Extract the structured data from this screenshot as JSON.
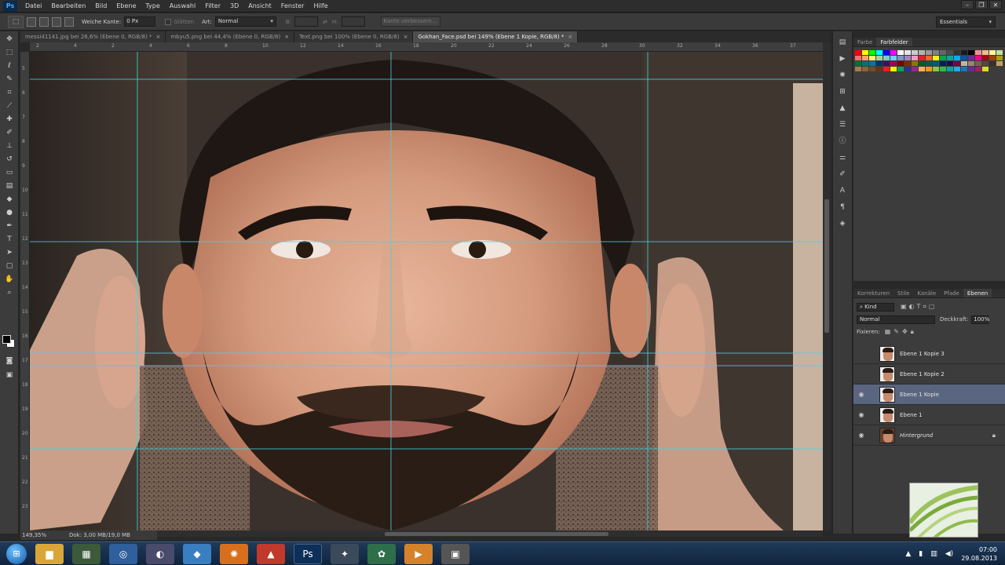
{
  "app": {
    "logo": "Ps"
  },
  "menu": [
    "Datei",
    "Bearbeiten",
    "Bild",
    "Ebene",
    "Type",
    "Auswahl",
    "Filter",
    "3D",
    "Ansicht",
    "Fenster",
    "Hilfe"
  ],
  "window_controls": {
    "minimize": "–",
    "restore": "❐",
    "close": "✕"
  },
  "options_bar": {
    "feather_label": "Weiche Kante:",
    "feather_value": "0 Px",
    "antialias_label": "Glätten",
    "style_label": "Art:",
    "style_value": "Normal",
    "width_label": "B:",
    "height_label": "H:",
    "refine_button": "Kante verbessern...",
    "workspace": "Essentials"
  },
  "tabs": [
    {
      "label": "messi41141.jpg bei 26,6% (Ebene 0, RGB/8) *",
      "close": "×",
      "active": false
    },
    {
      "label": "mbyu5.png bei 44,4% (Ebene 0, RGB/8)",
      "close": "×",
      "active": false
    },
    {
      "label": "Text.png bei 100% (Ebene 0, RGB/8)",
      "close": "×",
      "active": false
    },
    {
      "label": "Gokhan_Face.psd bei 149% (Ebene 1 Kopie, RGB/8) *",
      "close": "×",
      "active": true
    }
  ],
  "ruler_h": [
    "2",
    "4",
    "2",
    "4",
    "6",
    "8",
    "10",
    "12",
    "14",
    "16",
    "18",
    "20",
    "22",
    "24",
    "26",
    "28",
    "30",
    "32",
    "34",
    "36",
    "37"
  ],
  "ruler_v": [
    "5",
    "6",
    "7",
    "8",
    "9",
    "10",
    "11",
    "12",
    "13",
    "14",
    "15",
    "16",
    "17",
    "18",
    "19",
    "20",
    "21",
    "22",
    "23"
  ],
  "status": {
    "zoom": "149,35%",
    "doc": "Dok: 3,00 MB/19,0 MB"
  },
  "color_panel": {
    "tabs": [
      "Farbe",
      "Farbfelder"
    ],
    "active": "Farbfelder"
  },
  "swatches": [
    "#ff0000",
    "#ffff00",
    "#00ff00",
    "#00ffff",
    "#0000ff",
    "#ff00ff",
    "#ffffff",
    "#e6e6e6",
    "#cccccc",
    "#b3b3b3",
    "#999999",
    "#808080",
    "#666666",
    "#4d4d4d",
    "#333333",
    "#1a1a1a",
    "#000000",
    "#f28d8d",
    "#f6b98c",
    "#fff799",
    "#c4df9b",
    "#f46f6f",
    "#f7a46c",
    "#fff46e",
    "#a3d39c",
    "#7accc8",
    "#6dcff6",
    "#8393ca",
    "#a186be",
    "#f49ac1",
    "#ed1c24",
    "#f26522",
    "#fff200",
    "#00a651",
    "#00a99d",
    "#00aeef",
    "#0054a6",
    "#662d91",
    "#ec008c",
    "#9e0b0f",
    "#a0410d",
    "#aba000",
    "#007236",
    "#00746b",
    "#0076a3",
    "#003471",
    "#440e62",
    "#9e005d",
    "#790000",
    "#7b2e00",
    "#827b00",
    "#005e20",
    "#005952",
    "#005b7f",
    "#002157",
    "#32004b",
    "#7b0046",
    "#c7b299",
    "#998675",
    "#736357",
    "#534741",
    "#37302a",
    "#c69c6d",
    "#a67c52",
    "#8c6239",
    "#754c24",
    "#603913",
    "#ed1c24",
    "#fff200",
    "#00a651",
    "#2e3192",
    "#92278f",
    "#fbaf5d",
    "#f7941d",
    "#8dc63f",
    "#39b54a",
    "#00a99d",
    "#27aae1",
    "#1c75bc",
    "#662d91",
    "#9e1f63",
    "#d7df23"
  ],
  "layers_panel": {
    "tabs": [
      "Korrekturen",
      "Stile",
      "Kanäle",
      "Pfade",
      "Ebenen"
    ],
    "active": "Ebenen",
    "filter_label": "Kind",
    "blend_mode": "Normal",
    "opacity_label": "Deckkraft:",
    "opacity_value": "100%",
    "lock_label": "Fixieren:",
    "layers": [
      {
        "name": "Ebene 1 Kopie 3",
        "visible": false,
        "selected": false,
        "italic": false,
        "locked": false
      },
      {
        "name": "Ebene 1 Kopie 2",
        "visible": false,
        "selected": false,
        "italic": false,
        "locked": false
      },
      {
        "name": "Ebene 1 Kopie",
        "visible": true,
        "selected": true,
        "italic": false,
        "locked": false
      },
      {
        "name": "Ebene 1",
        "visible": true,
        "selected": false,
        "italic": false,
        "locked": false
      },
      {
        "name": "Hintergrund",
        "visible": true,
        "selected": false,
        "italic": true,
        "locked": true
      }
    ]
  },
  "taskbar": {
    "clock_time": "07:00",
    "clock_date": "29.08.2013"
  }
}
